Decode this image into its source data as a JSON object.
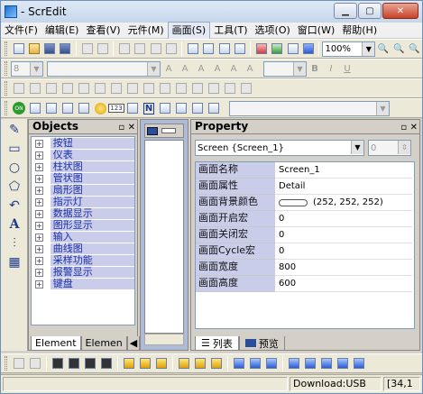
{
  "window": {
    "title": "- ScrEdit"
  },
  "menu": [
    "文件(F)",
    "编辑(E)",
    "查看(V)",
    "元件(M)",
    "画面(S)",
    "工具(T)",
    "选项(O)",
    "窗口(W)",
    "帮助(H)"
  ],
  "menu_active_index": 4,
  "toolbar": {
    "zoom_value": "100%",
    "font_size_value": "8"
  },
  "objects_panel": {
    "title": "Objects",
    "items": [
      "按钮",
      "仪表",
      "柱状图",
      "管状图",
      "扇形图",
      "指示灯",
      "数据显示",
      "图形显示",
      "输入",
      "曲线图",
      "采样功能",
      "报警显示",
      "键盘"
    ],
    "tabs": [
      "Element",
      "Elemen"
    ]
  },
  "property_panel": {
    "title": "Property",
    "selector_value": "Screen {Screen_1}",
    "spin_value": "0",
    "rows": [
      {
        "key": "画面名称",
        "value": "Screen_1"
      },
      {
        "key": "画面属性",
        "value": "Detail"
      },
      {
        "key": "画面背景颜色",
        "value": "(252, 252, 252)"
      },
      {
        "key": "画面开启宏",
        "value": "0"
      },
      {
        "key": "画面关闭宏",
        "value": "0"
      },
      {
        "key": "画面Cycle宏",
        "value": "0"
      },
      {
        "key": "画面宽度",
        "value": "800"
      },
      {
        "key": "画面高度",
        "value": "600"
      }
    ],
    "bg_color": "#fcfcfc",
    "tabs": [
      "列表",
      "预览"
    ]
  },
  "status": {
    "download": "Download:USB",
    "coords": "[34,1"
  },
  "colors": {
    "accent": "#c9cdea",
    "tree_text": "#1b2ea8"
  }
}
